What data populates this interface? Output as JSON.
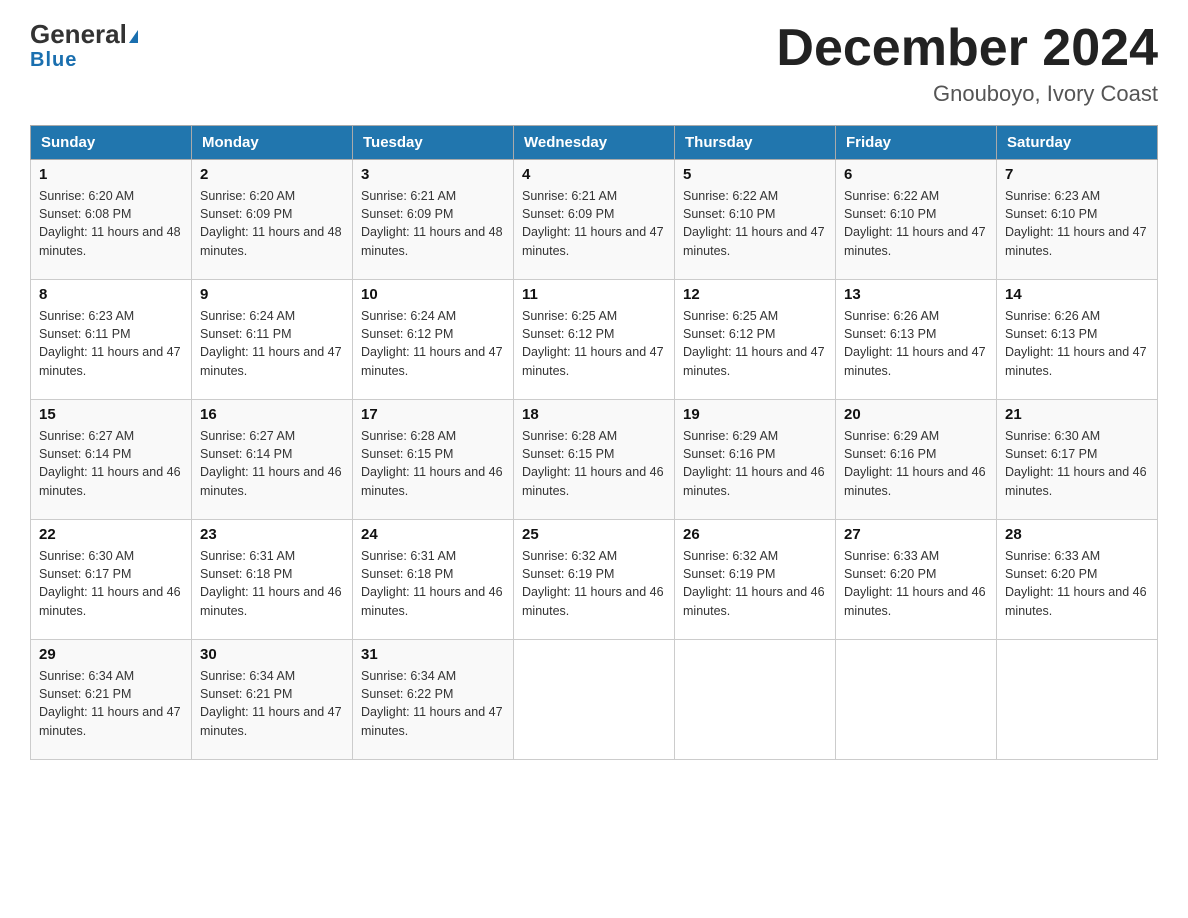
{
  "logo": {
    "general": "General",
    "triangle": "▶",
    "blue": "Blue"
  },
  "title": "December 2024",
  "location": "Gnouboyo, Ivory Coast",
  "days_of_week": [
    "Sunday",
    "Monday",
    "Tuesday",
    "Wednesday",
    "Thursday",
    "Friday",
    "Saturday"
  ],
  "weeks": [
    [
      {
        "day": "1",
        "sunrise": "6:20 AM",
        "sunset": "6:08 PM",
        "daylight": "11 hours and 48 minutes."
      },
      {
        "day": "2",
        "sunrise": "6:20 AM",
        "sunset": "6:09 PM",
        "daylight": "11 hours and 48 minutes."
      },
      {
        "day": "3",
        "sunrise": "6:21 AM",
        "sunset": "6:09 PM",
        "daylight": "11 hours and 48 minutes."
      },
      {
        "day": "4",
        "sunrise": "6:21 AM",
        "sunset": "6:09 PM",
        "daylight": "11 hours and 47 minutes."
      },
      {
        "day": "5",
        "sunrise": "6:22 AM",
        "sunset": "6:10 PM",
        "daylight": "11 hours and 47 minutes."
      },
      {
        "day": "6",
        "sunrise": "6:22 AM",
        "sunset": "6:10 PM",
        "daylight": "11 hours and 47 minutes."
      },
      {
        "day": "7",
        "sunrise": "6:23 AM",
        "sunset": "6:10 PM",
        "daylight": "11 hours and 47 minutes."
      }
    ],
    [
      {
        "day": "8",
        "sunrise": "6:23 AM",
        "sunset": "6:11 PM",
        "daylight": "11 hours and 47 minutes."
      },
      {
        "day": "9",
        "sunrise": "6:24 AM",
        "sunset": "6:11 PM",
        "daylight": "11 hours and 47 minutes."
      },
      {
        "day": "10",
        "sunrise": "6:24 AM",
        "sunset": "6:12 PM",
        "daylight": "11 hours and 47 minutes."
      },
      {
        "day": "11",
        "sunrise": "6:25 AM",
        "sunset": "6:12 PM",
        "daylight": "11 hours and 47 minutes."
      },
      {
        "day": "12",
        "sunrise": "6:25 AM",
        "sunset": "6:12 PM",
        "daylight": "11 hours and 47 minutes."
      },
      {
        "day": "13",
        "sunrise": "6:26 AM",
        "sunset": "6:13 PM",
        "daylight": "11 hours and 47 minutes."
      },
      {
        "day": "14",
        "sunrise": "6:26 AM",
        "sunset": "6:13 PM",
        "daylight": "11 hours and 47 minutes."
      }
    ],
    [
      {
        "day": "15",
        "sunrise": "6:27 AM",
        "sunset": "6:14 PM",
        "daylight": "11 hours and 46 minutes."
      },
      {
        "day": "16",
        "sunrise": "6:27 AM",
        "sunset": "6:14 PM",
        "daylight": "11 hours and 46 minutes."
      },
      {
        "day": "17",
        "sunrise": "6:28 AM",
        "sunset": "6:15 PM",
        "daylight": "11 hours and 46 minutes."
      },
      {
        "day": "18",
        "sunrise": "6:28 AM",
        "sunset": "6:15 PM",
        "daylight": "11 hours and 46 minutes."
      },
      {
        "day": "19",
        "sunrise": "6:29 AM",
        "sunset": "6:16 PM",
        "daylight": "11 hours and 46 minutes."
      },
      {
        "day": "20",
        "sunrise": "6:29 AM",
        "sunset": "6:16 PM",
        "daylight": "11 hours and 46 minutes."
      },
      {
        "day": "21",
        "sunrise": "6:30 AM",
        "sunset": "6:17 PM",
        "daylight": "11 hours and 46 minutes."
      }
    ],
    [
      {
        "day": "22",
        "sunrise": "6:30 AM",
        "sunset": "6:17 PM",
        "daylight": "11 hours and 46 minutes."
      },
      {
        "day": "23",
        "sunrise": "6:31 AM",
        "sunset": "6:18 PM",
        "daylight": "11 hours and 46 minutes."
      },
      {
        "day": "24",
        "sunrise": "6:31 AM",
        "sunset": "6:18 PM",
        "daylight": "11 hours and 46 minutes."
      },
      {
        "day": "25",
        "sunrise": "6:32 AM",
        "sunset": "6:19 PM",
        "daylight": "11 hours and 46 minutes."
      },
      {
        "day": "26",
        "sunrise": "6:32 AM",
        "sunset": "6:19 PM",
        "daylight": "11 hours and 46 minutes."
      },
      {
        "day": "27",
        "sunrise": "6:33 AM",
        "sunset": "6:20 PM",
        "daylight": "11 hours and 46 minutes."
      },
      {
        "day": "28",
        "sunrise": "6:33 AM",
        "sunset": "6:20 PM",
        "daylight": "11 hours and 46 minutes."
      }
    ],
    [
      {
        "day": "29",
        "sunrise": "6:34 AM",
        "sunset": "6:21 PM",
        "daylight": "11 hours and 47 minutes."
      },
      {
        "day": "30",
        "sunrise": "6:34 AM",
        "sunset": "6:21 PM",
        "daylight": "11 hours and 47 minutes."
      },
      {
        "day": "31",
        "sunrise": "6:34 AM",
        "sunset": "6:22 PM",
        "daylight": "11 hours and 47 minutes."
      },
      null,
      null,
      null,
      null
    ]
  ]
}
